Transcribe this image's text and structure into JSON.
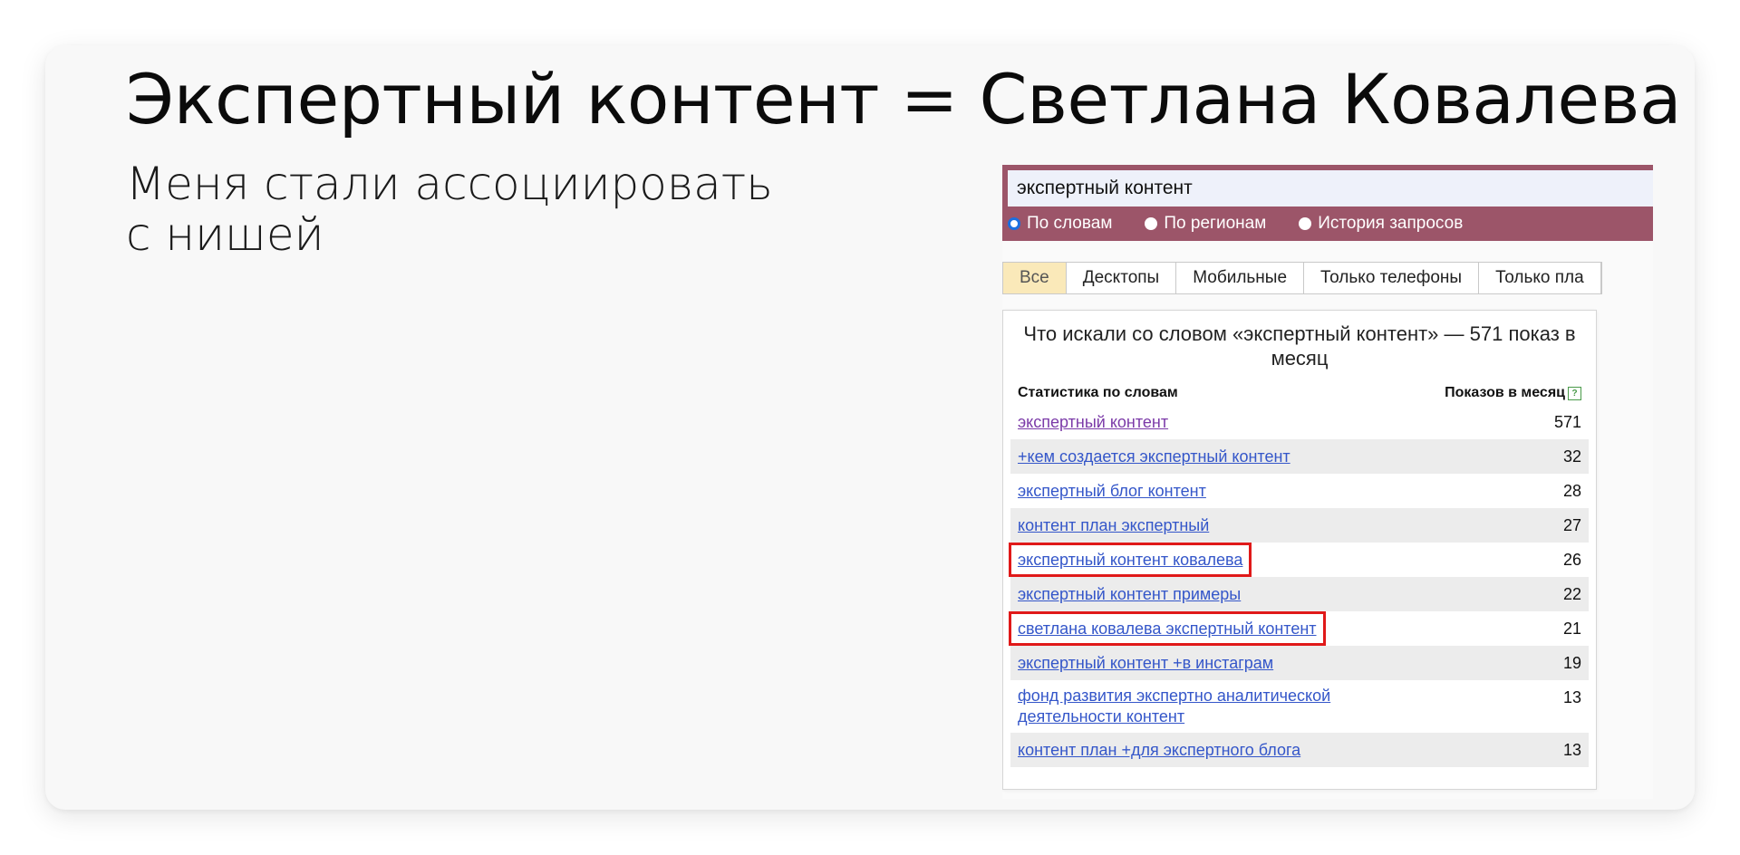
{
  "slide": {
    "title": "Экспертный контент = Светлана Ковалева",
    "subtitle_lines": [
      "Меня стали ассоциировать",
      "с нишей"
    ]
  },
  "wordstat": {
    "search_value": "экспертный контент",
    "radios": [
      {
        "label": "По словам",
        "selected": true
      },
      {
        "label": "По регионам",
        "selected": false
      },
      {
        "label": "История запросов",
        "selected": false
      }
    ],
    "tabs": [
      "Все",
      "Десктопы",
      "Мобильные",
      "Только телефоны",
      "Только пла"
    ],
    "active_tab": "Все",
    "heading": "Что искали со словом «экспертный контент» — 571 показ в месяц",
    "col_left": "Статистика по словам",
    "col_right": "Показов в месяц",
    "help_icon": "?",
    "rows": [
      {
        "keyword": "экспертный контент",
        "count": "571",
        "visited": true,
        "highlighted": false
      },
      {
        "keyword": "+кем создается экспертный контент",
        "count": "32",
        "visited": false,
        "highlighted": false
      },
      {
        "keyword": "экспертный блог контент",
        "count": "28",
        "visited": false,
        "highlighted": false
      },
      {
        "keyword": "контент план экспертный",
        "count": "27",
        "visited": false,
        "highlighted": false
      },
      {
        "keyword": "экспертный контент ковалева",
        "count": "26",
        "visited": false,
        "highlighted": true
      },
      {
        "keyword": "экспертный контент примеры",
        "count": "22",
        "visited": false,
        "highlighted": false
      },
      {
        "keyword": "светлана ковалева экспертный контент",
        "count": "21",
        "visited": false,
        "highlighted": true
      },
      {
        "keyword": "экспертный контент +в инстаграм",
        "count": "19",
        "visited": false,
        "highlighted": false
      },
      {
        "keyword": "фонд развития экспертно аналитической деятельности контент",
        "count": "13",
        "visited": false,
        "highlighted": false
      },
      {
        "keyword": "контент план +для экспертного блога",
        "count": "13",
        "visited": false,
        "highlighted": false
      }
    ],
    "colors": {
      "bar": "#9c5569",
      "link": "#3456c9",
      "visited": "#7b3aa8",
      "highlight": "#e01919",
      "active_tab": "#fae9b9"
    }
  }
}
